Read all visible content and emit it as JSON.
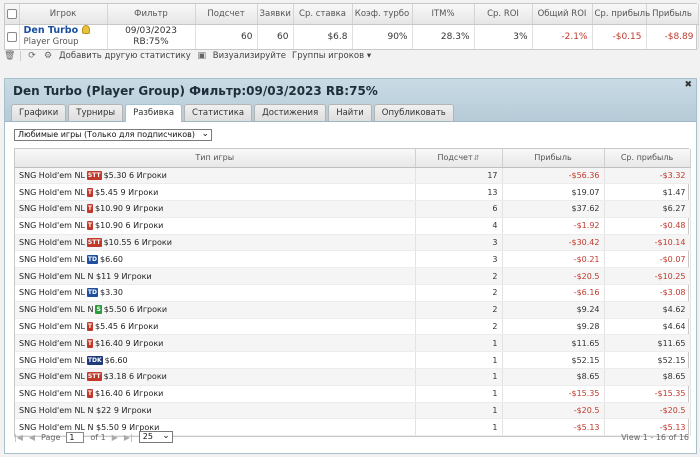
{
  "top_grid": {
    "headers": [
      "Игрок",
      "Фильтр",
      "Подсчет",
      "Заявки",
      "Ср. ставка",
      "Коэф. турбо",
      "ITM%",
      "Ср. ROI",
      "Общий ROI",
      "Ср. прибыль",
      "Прибыль"
    ],
    "row": {
      "player": "Den Turbo",
      "group": "Player Group",
      "filter_date": "09/03/2023",
      "filter_rb": "RB:75%",
      "count": "60",
      "entries": "60",
      "avg_stake": "$6.8",
      "turbo": "90%",
      "itm": "28.3%",
      "avg_roi": "3%",
      "total_roi": "-2.1%",
      "avg_profit": "-$0.15",
      "profit": "-$8.89"
    }
  },
  "toolbar": {
    "add_stats": "Добавить другую статистику",
    "visualize": "Визуализируйте",
    "player_groups": "Группы игроков"
  },
  "panel": {
    "title": "Den Turbo (Player Group) Фильтр:09/03/2023 RB:75%",
    "tabs": [
      "Графики",
      "Турниры",
      "Разбивка",
      "Статистика",
      "Достижения",
      "Найти",
      "Опубликовать"
    ],
    "active_tab": 2,
    "select_value": "Любимые игры (Только для подписчиков)"
  },
  "main_grid": {
    "headers": [
      "Тип игры",
      "Подсчет",
      "Прибыль",
      "Ср. прибыль"
    ],
    "rows": [
      {
        "prefix": "SNG Hold'em NL",
        "badge": "STT",
        "badge_color": "#c0392b",
        "rest": "$5.30 6 Игроки",
        "count": "17",
        "profit": "-$56.36",
        "avg": "-$3.32"
      },
      {
        "prefix": "SNG Hold'em NL",
        "badge": "T",
        "badge_color": "#c0392b",
        "rest": "$5.45 9 Игроки",
        "count": "13",
        "profit": "$19.07",
        "avg": "$1.47"
      },
      {
        "prefix": "SNG Hold'em NL",
        "badge": "T",
        "badge_color": "#c0392b",
        "rest": "$10.90 9 Игроки",
        "count": "6",
        "profit": "$37.62",
        "avg": "$6.27"
      },
      {
        "prefix": "SNG Hold'em NL",
        "badge": "T",
        "badge_color": "#c0392b",
        "rest": "$10.90 6 Игроки",
        "count": "4",
        "profit": "-$1.92",
        "avg": "-$0.48"
      },
      {
        "prefix": "SNG Hold'em NL",
        "badge": "STT",
        "badge_color": "#c0392b",
        "rest": "$10.55 6 Игроки",
        "count": "3",
        "profit": "-$30.42",
        "avg": "-$10.14"
      },
      {
        "prefix": "SNG Hold'em NL",
        "badge": "TD",
        "badge_color": "#1f4f9c",
        "rest": "$6.60",
        "count": "3",
        "profit": "-$0.21",
        "avg": "-$0.07"
      },
      {
        "prefix": "SNG Hold'em NL N",
        "badge": "",
        "badge_color": "",
        "rest": "$11 9 Игроки",
        "count": "2",
        "profit": "-$20.5",
        "avg": "-$10.25"
      },
      {
        "prefix": "SNG Hold'em NL",
        "badge": "TD",
        "badge_color": "#1f4f9c",
        "rest": "$3.30",
        "count": "2",
        "profit": "-$6.16",
        "avg": "-$3.08"
      },
      {
        "prefix": "SNG Hold'em NL N",
        "badge": "S",
        "badge_color": "#2e9b3f",
        "rest": "$5.50 6 Игроки",
        "count": "2",
        "profit": "$9.24",
        "avg": "$4.62"
      },
      {
        "prefix": "SNG Hold'em NL",
        "badge": "T",
        "badge_color": "#c0392b",
        "rest": "$5.45 6 Игроки",
        "count": "2",
        "profit": "$9.28",
        "avg": "$4.64"
      },
      {
        "prefix": "SNG Hold'em NL",
        "badge": "T",
        "badge_color": "#c0392b",
        "rest": "$16.40 9 Игроки",
        "count": "1",
        "profit": "$11.65",
        "avg": "$11.65"
      },
      {
        "prefix": "SNG Hold'em NL",
        "badge": "TDK",
        "badge_color": "#1f3a7a",
        "rest": "$6.60",
        "count": "1",
        "profit": "$52.15",
        "avg": "$52.15"
      },
      {
        "prefix": "SNG Hold'em NL",
        "badge": "STT",
        "badge_color": "#c0392b",
        "rest": "$3.18 6 Игроки",
        "count": "1",
        "profit": "$8.65",
        "avg": "$8.65"
      },
      {
        "prefix": "SNG Hold'em NL",
        "badge": "T",
        "badge_color": "#c0392b",
        "rest": "$16.40 6 Игроки",
        "count": "1",
        "profit": "-$15.35",
        "avg": "-$15.35"
      },
      {
        "prefix": "SNG Hold'em NL N",
        "badge": "",
        "badge_color": "",
        "rest": "$22 9 Игроки",
        "count": "1",
        "profit": "-$20.5",
        "avg": "-$20.5"
      },
      {
        "prefix": "SNG Hold'em NL N",
        "badge": "",
        "badge_color": "",
        "rest": "$5.50 9 Игроки",
        "count": "1",
        "profit": "-$5.13",
        "avg": "-$5.13"
      }
    ]
  },
  "pager": {
    "page_label": "Page",
    "page_value": "1",
    "of_label": "of 1",
    "per_page": "25",
    "view_text": "View 1 - 16 of 16"
  }
}
